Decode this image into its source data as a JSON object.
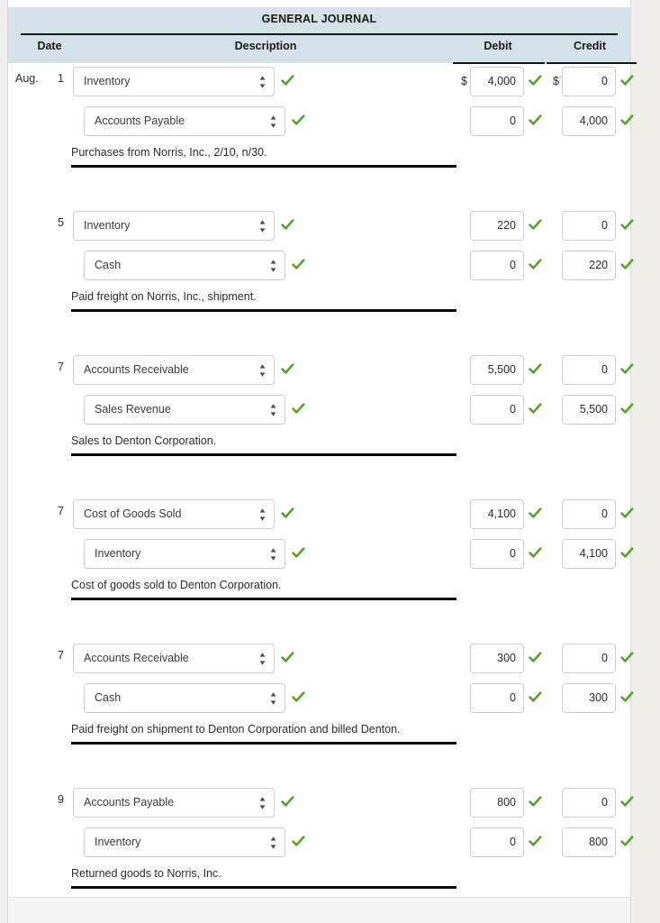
{
  "journal": {
    "title": "GENERAL JOURNAL",
    "columns": {
      "date": "Date",
      "description": "Description",
      "debit": "Debit",
      "credit": "Credit"
    },
    "currency_symbol": "$",
    "check_icon": "check-icon",
    "select_arrows_icon": "updown-arrows-icon",
    "colors": {
      "header_background": "#d3e0e8",
      "check_green": "#5c9e31",
      "rule_black": "#0c0c0c",
      "panel_background": "#ffffff",
      "page_background": "#efeeec"
    },
    "entries": [
      {
        "month": "Aug.",
        "day": "1",
        "show_currency": true,
        "lines": [
          {
            "account": "Inventory",
            "debit": "4,000",
            "credit": "0"
          },
          {
            "account": "Accounts Payable",
            "debit": "0",
            "credit": "4,000"
          }
        ],
        "memo": "Purchases from Norris, Inc., 2/10, n/30."
      },
      {
        "month": "",
        "day": "5",
        "show_currency": false,
        "lines": [
          {
            "account": "Inventory",
            "debit": "220",
            "credit": "0"
          },
          {
            "account": "Cash",
            "debit": "0",
            "credit": "220"
          }
        ],
        "memo": "Paid freight on Norris, Inc., shipment."
      },
      {
        "month": "",
        "day": "7",
        "show_currency": false,
        "lines": [
          {
            "account": "Accounts Receivable",
            "debit": "5,500",
            "credit": "0"
          },
          {
            "account": "Sales Revenue",
            "debit": "0",
            "credit": "5,500"
          }
        ],
        "memo": "Sales to Denton Corporation."
      },
      {
        "month": "",
        "day": "7",
        "show_currency": false,
        "lines": [
          {
            "account": "Cost of Goods Sold",
            "debit": "4,100",
            "credit": "0"
          },
          {
            "account": "Inventory",
            "debit": "0",
            "credit": "4,100"
          }
        ],
        "memo": "Cost of goods sold to Denton Corporation."
      },
      {
        "month": "",
        "day": "7",
        "show_currency": false,
        "lines": [
          {
            "account": "Accounts Receivable",
            "debit": "300",
            "credit": "0"
          },
          {
            "account": "Cash",
            "debit": "0",
            "credit": "300"
          }
        ],
        "memo": "Paid freight on shipment to Denton Corporation and billed Denton."
      },
      {
        "month": "",
        "day": "9",
        "show_currency": false,
        "lines": [
          {
            "account": "Accounts Payable",
            "debit": "800",
            "credit": "0"
          },
          {
            "account": "Inventory",
            "debit": "0",
            "credit": "800"
          }
        ],
        "memo": "Returned goods to Norris, Inc."
      }
    ]
  }
}
